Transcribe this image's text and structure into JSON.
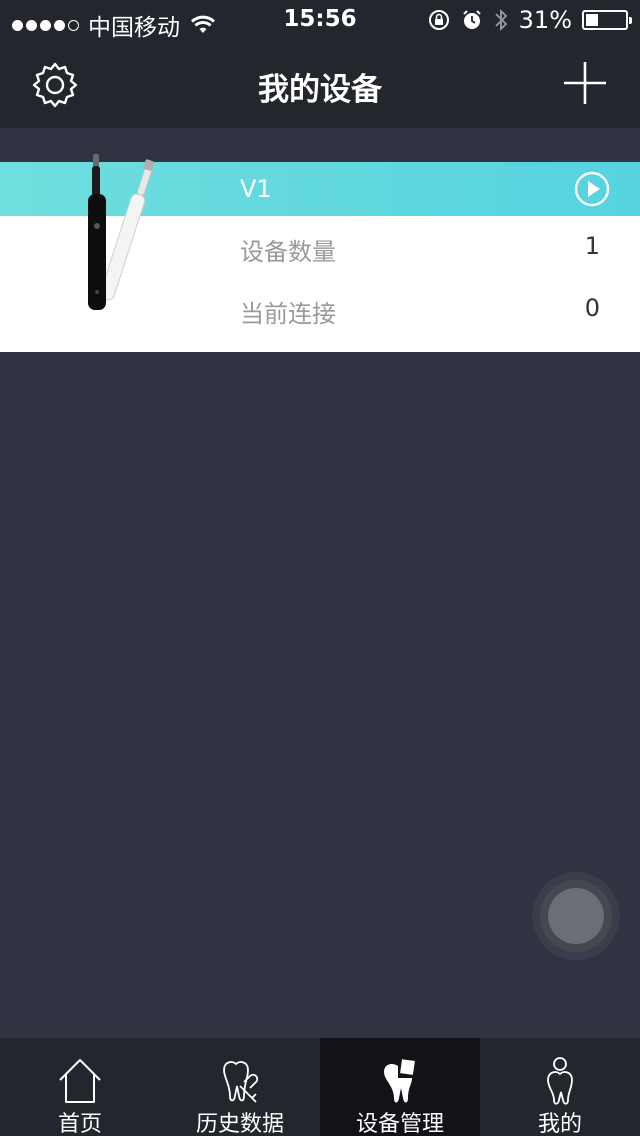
{
  "status_bar": {
    "carrier": "中国移动",
    "time": "15:56",
    "battery_text": "31%",
    "battery_level": 0.31,
    "signal_bars_filled": 4,
    "signal_bars_total": 5
  },
  "header": {
    "title": "我的设备"
  },
  "device": {
    "name": "V1",
    "rows": [
      {
        "label": "设备数量",
        "value": "1"
      },
      {
        "label": "当前连接",
        "value": "0"
      }
    ]
  },
  "tabs": [
    {
      "label": "首页",
      "icon": "home-icon",
      "active": false
    },
    {
      "label": "历史数据",
      "icon": "tooth-history-icon",
      "active": false
    },
    {
      "label": "设备管理",
      "icon": "tooth-device-icon",
      "active": true
    },
    {
      "label": "我的",
      "icon": "tooth-user-icon",
      "active": false
    }
  ],
  "colors": {
    "background": "#303442",
    "bar": "#23262d",
    "accent": "#55d3df",
    "active_tab": "#111317"
  }
}
